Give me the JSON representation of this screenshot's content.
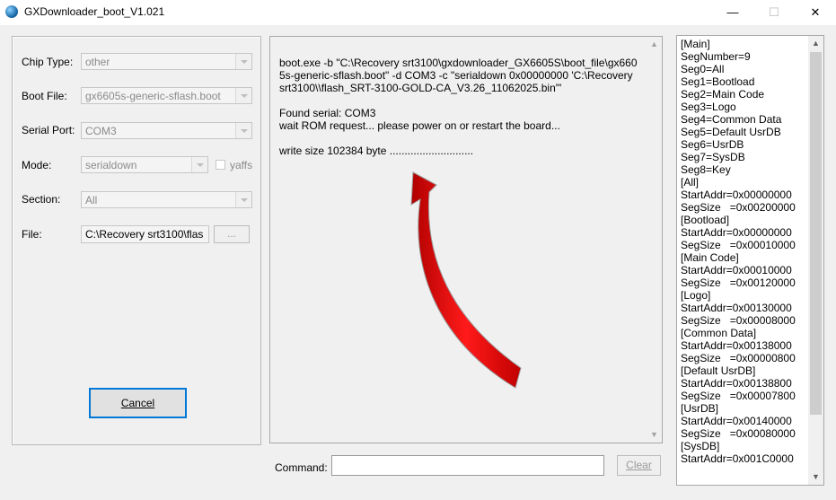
{
  "window": {
    "title": "GXDownloader_boot_V1.021",
    "minimize_glyph": "—",
    "maximize_glyph": "☐",
    "close_glyph": "✕"
  },
  "settings": {
    "chip_type": {
      "label": "Chip Type:",
      "value": "other"
    },
    "boot_file": {
      "label": "Boot File:",
      "value": "gx6605s-generic-sflash.boot"
    },
    "serial_port": {
      "label": "Serial Port:",
      "value": "COM3"
    },
    "mode": {
      "label": "Mode:",
      "value": "serialdown"
    },
    "yaffs": {
      "label": "yaffs"
    },
    "section": {
      "label": "Section:",
      "value": "All"
    },
    "file": {
      "label": "File:",
      "value": "C:\\Recovery srt3100\\flas",
      "browse_label": "..."
    },
    "cancel_label": "Cancel"
  },
  "output": {
    "lines": [
      "boot.exe -b \"C:\\Recovery srt3100\\gxdownloader_GX6605S\\boot_file\\gx6605s-generic-sflash.boot\" -d COM3 -c \"serialdown 0x00000000 'C:\\Recovery srt3100\\\\flash_SRT-3100-GOLD-CA_V3.26_11062025.bin'\"",
      "Found serial: COM3\nwait ROM request... please power on or restart the board...",
      "write size 102384 byte ............................"
    ]
  },
  "command": {
    "label": "Command:",
    "value": "",
    "clear_label": "Clear"
  },
  "segments": [
    "[Main]",
    "SegNumber=9",
    "Seg0=All",
    "Seg1=Bootload",
    "Seg2=Main Code",
    "Seg3=Logo",
    "Seg4=Common Data",
    "Seg5=Default UsrDB",
    "Seg6=UsrDB",
    "Seg7=SysDB",
    "Seg8=Key",
    "[All]",
    "StartAddr=0x00000000",
    "SegSize   =0x00200000",
    "[Bootload]",
    "StartAddr=0x00000000",
    "SegSize   =0x00010000",
    "[Main Code]",
    "StartAddr=0x00010000",
    "SegSize   =0x00120000",
    "[Logo]",
    "StartAddr=0x00130000",
    "SegSize   =0x00008000",
    "[Common Data]",
    "StartAddr=0x00138000",
    "SegSize   =0x00000800",
    "[Default UsrDB]",
    "StartAddr=0x00138800",
    "SegSize   =0x00007800",
    "[UsrDB]",
    "StartAddr=0x00140000",
    "SegSize   =0x00080000",
    "[SysDB]",
    "StartAddr=0x001C0000"
  ],
  "annotation": {
    "arrow_color": "#e00000"
  }
}
